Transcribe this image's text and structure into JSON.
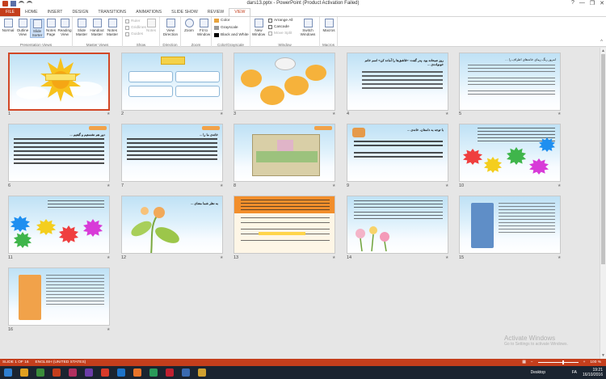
{
  "window": {
    "title": "dars13.pptx - PowerPoint (Product Activation Failed)",
    "controls": [
      "?",
      "—",
      "❐",
      "✕"
    ]
  },
  "tabs": [
    "FILE",
    "HOME",
    "INSERT",
    "DESIGN",
    "TRANSITIONS",
    "ANIMATIONS",
    "SLIDE SHOW",
    "REVIEW",
    "VIEW"
  ],
  "active_tab": "VIEW",
  "ribbon": {
    "presentation_views": {
      "label": "Presentation Views",
      "buttons": [
        "Normal",
        "Outline View",
        "Slide Sorter",
        "Notes Page",
        "Reading View"
      ]
    },
    "master_views": {
      "label": "Master Views",
      "buttons": [
        "Slide Master",
        "Handout Master",
        "Notes Master"
      ]
    },
    "show": {
      "label": "Show",
      "items": [
        "Ruler",
        "Gridlines",
        "Guides"
      ],
      "notes": "Notes"
    },
    "direction": {
      "label": "Direction",
      "button": "View Direction"
    },
    "zoom": {
      "label": "Zoom",
      "buttons": [
        "Zoom",
        "Fit to Window"
      ]
    },
    "color_grayscale": {
      "label": "Color/Grayscale",
      "items": [
        "Color",
        "Grayscale",
        "Black and White"
      ]
    },
    "window": {
      "label": "Window",
      "new_window": "New Window",
      "items": [
        "Arrange All",
        "Cascade",
        "Move Split"
      ],
      "switch": "Switch Windows"
    },
    "macros": {
      "label": "Macros",
      "button": "Macros"
    }
  },
  "slides": [
    {
      "num": "1"
    },
    {
      "num": "2"
    },
    {
      "num": "3"
    },
    {
      "num": "4"
    },
    {
      "num": "5"
    },
    {
      "num": "6"
    },
    {
      "num": "7"
    },
    {
      "num": "8"
    },
    {
      "num": "9"
    },
    {
      "num": "10"
    },
    {
      "num": "11"
    },
    {
      "num": "12"
    },
    {
      "num": "13"
    },
    {
      "num": "14"
    },
    {
      "num": "15"
    },
    {
      "num": "16"
    }
  ],
  "slide_text": {
    "s4": "روز صبحانه بود.\nپدر گفت: «قاشق‌ها را آماده کن»\nاسم خانم خونواده‌ی ...",
    "s5": "امروز رنگ زیبای خانه‌های اطراف را ...",
    "s6": "دور هم نشستیم و گفتیم ...",
    "s7": "خانه‌ی ما را ...",
    "s9": "با توجه به داستان، خانه‌ی ...",
    "s12": "به نظر شما معنای ..."
  },
  "status": {
    "slide_info": "SLIDE 1 OF 16",
    "language": "ENGLISH (UNITED STATES)",
    "zoom": "100 %"
  },
  "watermark": {
    "line1": "Activate Windows",
    "line2": "Go to Settings to activate Windows."
  },
  "taskbar": {
    "desktop": "Desktop",
    "time": "19:21",
    "date": "16/10/2016",
    "lang": "FA"
  },
  "colors": {
    "accent": "#c43e1c",
    "selection": "#d24726",
    "sky_top": "#bfe1f5"
  }
}
